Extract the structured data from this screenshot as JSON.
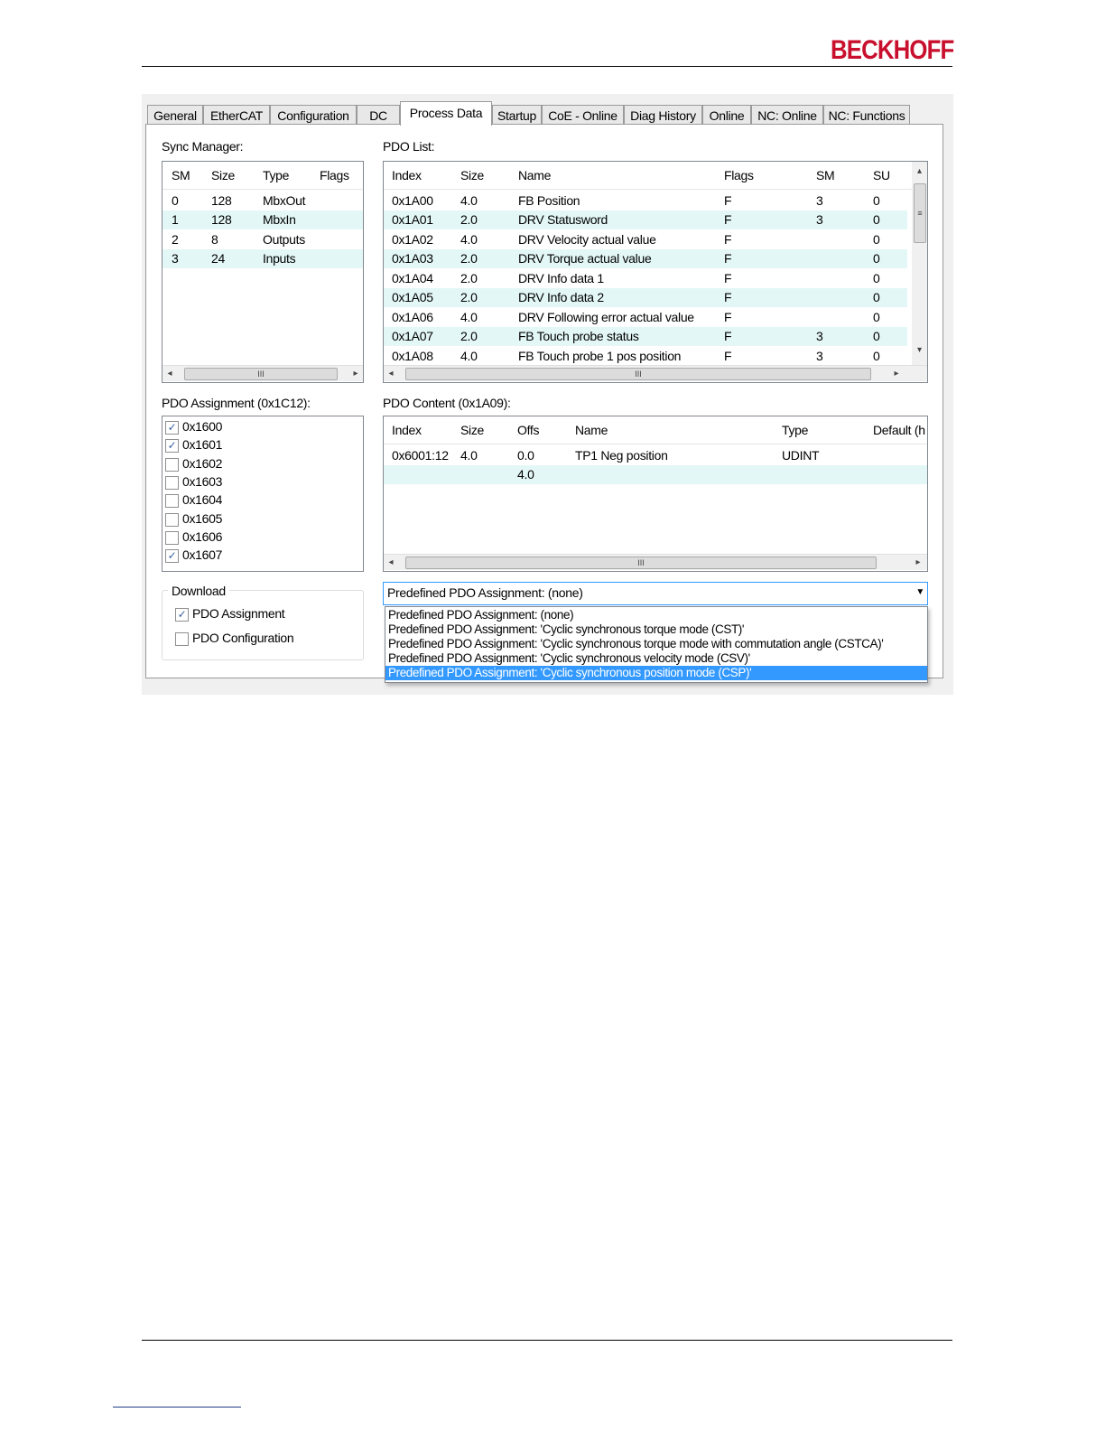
{
  "header": {
    "logo_text": "BECKHOFF",
    "brand_color": "#c8102e"
  },
  "tabs": [
    "General",
    "EtherCAT",
    "Configuration",
    "DC",
    "Process Data",
    "Startup",
    "CoE - Online",
    "Diag History",
    "Online",
    "NC: Online",
    "NC: Functions"
  ],
  "active_tab": "Process Data",
  "sync_manager": {
    "label": "Sync Manager:",
    "columns": [
      "SM",
      "Size",
      "Type",
      "Flags"
    ],
    "rows": [
      [
        "0",
        "128",
        "MbxOut",
        ""
      ],
      [
        "1",
        "128",
        "MbxIn",
        ""
      ],
      [
        "2",
        "8",
        "Outputs",
        ""
      ],
      [
        "3",
        "24",
        "Inputs",
        ""
      ]
    ]
  },
  "pdo_list": {
    "label": "PDO List:",
    "columns": [
      "Index",
      "Size",
      "Name",
      "Flags",
      "SM",
      "SU"
    ],
    "rows": [
      [
        "0x1A00",
        "4.0",
        "FB Position",
        "F",
        "3",
        "0"
      ],
      [
        "0x1A01",
        "2.0",
        "DRV Statusword",
        "F",
        "3",
        "0"
      ],
      [
        "0x1A02",
        "4.0",
        "DRV Velocity actual value",
        "F",
        "",
        "0"
      ],
      [
        "0x1A03",
        "2.0",
        "DRV Torque actual value",
        "F",
        "",
        "0"
      ],
      [
        "0x1A04",
        "2.0",
        "DRV Info data 1",
        "F",
        "",
        "0"
      ],
      [
        "0x1A05",
        "2.0",
        "DRV Info data 2",
        "F",
        "",
        "0"
      ],
      [
        "0x1A06",
        "4.0",
        "DRV Following error actual value",
        "F",
        "",
        "0"
      ],
      [
        "0x1A07",
        "2.0",
        "FB Touch probe status",
        "F",
        "3",
        "0"
      ],
      [
        "0x1A08",
        "4.0",
        "FB Touch probe 1 pos position",
        "F",
        "3",
        "0"
      ]
    ]
  },
  "pdo_assignment": {
    "label": "PDO Assignment (0x1C12):",
    "items": [
      {
        "label": "0x1600",
        "checked": true
      },
      {
        "label": "0x1601",
        "checked": true
      },
      {
        "label": "0x1602",
        "checked": false
      },
      {
        "label": "0x1603",
        "checked": false
      },
      {
        "label": "0x1604",
        "checked": false
      },
      {
        "label": "0x1605",
        "checked": false
      },
      {
        "label": "0x1606",
        "checked": false
      },
      {
        "label": "0x1607",
        "checked": true
      }
    ]
  },
  "pdo_content": {
    "label": "PDO Content (0x1A09):",
    "columns": [
      "Index",
      "Size",
      "Offs",
      "Name",
      "Type",
      "Default (h"
    ],
    "rows": [
      [
        "0x6001:12",
        "4.0",
        "0.0",
        "TP1 Neg position",
        "UDINT",
        ""
      ],
      [
        "",
        "",
        "4.0",
        "",
        "",
        ""
      ]
    ]
  },
  "download": {
    "label": "Download",
    "pdo_assignment": {
      "label": "PDO Assignment",
      "checked": true
    },
    "pdo_configuration": {
      "label": "PDO Configuration",
      "checked": false
    }
  },
  "predefined": {
    "selected": "Predefined PDO Assignment: (none)",
    "options": [
      "Predefined PDO Assignment: (none)",
      "Predefined PDO Assignment: 'Cyclic synchronous torque mode (CST)'",
      "Predefined PDO Assignment: 'Cyclic synchronous torque mode with commutation angle (CSTCA)'",
      "Predefined PDO Assignment: 'Cyclic synchronous velocity mode (CSV)'",
      "Predefined PDO Assignment: 'Cyclic synchronous position mode (CSP)'"
    ],
    "highlighted_option": "Predefined PDO Assignment: 'Cyclic synchronous position mode (CSP)'",
    "highlight_color": "#3399ff"
  },
  "scroll_glyph": "III",
  "check_glyph": "✓"
}
